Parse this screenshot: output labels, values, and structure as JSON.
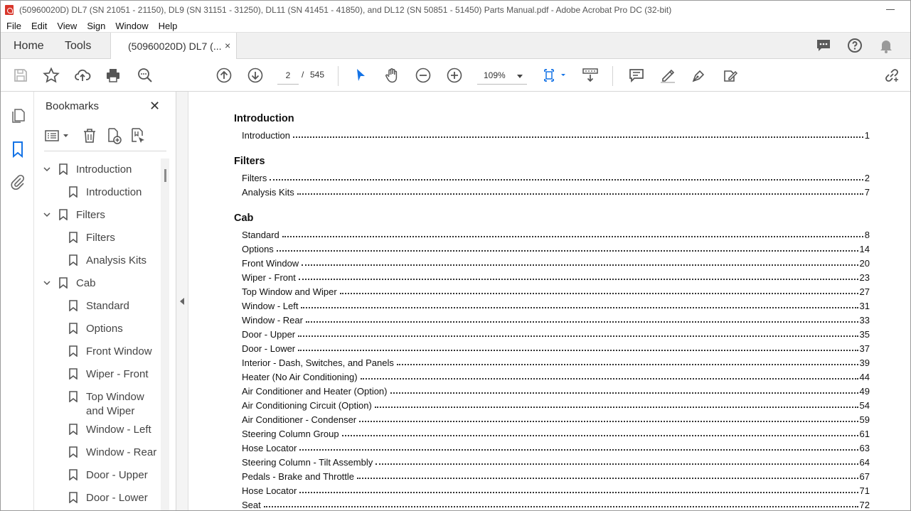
{
  "window": {
    "title": "(50960020D) DL7 (SN 21051 - 21150), DL9 (SN 31151 - 31250), DL11 (SN 41451 - 41850), and DL12 (SN 50851 - 51450) Parts Manual.pdf - Adobe Acrobat Pro DC (32-bit)"
  },
  "menu": [
    "File",
    "Edit",
    "View",
    "Sign",
    "Window",
    "Help"
  ],
  "tabs": {
    "home": "Home",
    "tools": "Tools",
    "document": "(50960020D) DL7 (...",
    "close": "×"
  },
  "toolbar": {
    "current_page": "2",
    "separator": "/",
    "total_pages": "545",
    "zoom": "109%"
  },
  "bookmarks": {
    "title": "Bookmarks",
    "close": "✕",
    "items": [
      {
        "label": "Introduction",
        "level": 0,
        "expanded": true
      },
      {
        "label": "Introduction",
        "level": 1
      },
      {
        "label": "Filters",
        "level": 0,
        "expanded": true
      },
      {
        "label": "Filters",
        "level": 1
      },
      {
        "label": "Analysis Kits",
        "level": 1
      },
      {
        "label": "Cab",
        "level": 0,
        "expanded": true
      },
      {
        "label": "Standard",
        "level": 1
      },
      {
        "label": "Options",
        "level": 1
      },
      {
        "label": "Front Window",
        "level": 1
      },
      {
        "label": "Wiper - Front",
        "level": 1
      },
      {
        "label": "Top Window and Wiper",
        "level": 1
      },
      {
        "label": "Window - Left",
        "level": 1
      },
      {
        "label": "Window - Rear",
        "level": 1
      },
      {
        "label": "Door - Upper",
        "level": 1
      },
      {
        "label": "Door - Lower",
        "level": 1
      }
    ]
  },
  "toc": {
    "sections": [
      {
        "heading": "Introduction",
        "entries": [
          {
            "title": "Introduction",
            "page": "1"
          }
        ]
      },
      {
        "heading": "Filters",
        "entries": [
          {
            "title": "Filters",
            "page": "2"
          },
          {
            "title": "Analysis Kits",
            "page": "7"
          }
        ]
      },
      {
        "heading": "Cab",
        "entries": [
          {
            "title": "Standard",
            "page": "8"
          },
          {
            "title": "Options",
            "page": "14"
          },
          {
            "title": "Front Window",
            "page": "20"
          },
          {
            "title": "Wiper - Front",
            "page": "23"
          },
          {
            "title": "Top Window and Wiper",
            "page": "27"
          },
          {
            "title": "Window - Left",
            "page": "31"
          },
          {
            "title": "Window - Rear",
            "page": "33"
          },
          {
            "title": "Door - Upper",
            "page": "35"
          },
          {
            "title": "Door - Lower",
            "page": "37"
          },
          {
            "title": "Interior - Dash, Switches, and Panels",
            "page": "39"
          },
          {
            "title": "Heater (No Air Conditioning)",
            "page": "44"
          },
          {
            "title": "Air Conditioner and Heater (Option)",
            "page": "49"
          },
          {
            "title": "Air Conditioning Circuit (Option)",
            "page": "54"
          },
          {
            "title": "Air Conditioner - Condenser",
            "page": "59"
          },
          {
            "title": "Steering Column Group",
            "page": "61"
          },
          {
            "title": "Hose Locator",
            "page": "63"
          },
          {
            "title": "Steering Column - Tilt Assembly",
            "page": "64"
          },
          {
            "title": "Pedals - Brake and Throttle",
            "page": "67"
          },
          {
            "title": "Hose Locator",
            "page": "71"
          },
          {
            "title": "Seat",
            "page": "72"
          }
        ]
      }
    ]
  },
  "colors": {
    "accent_blue": "#1473e6",
    "pdf_red": "#d8362b"
  }
}
